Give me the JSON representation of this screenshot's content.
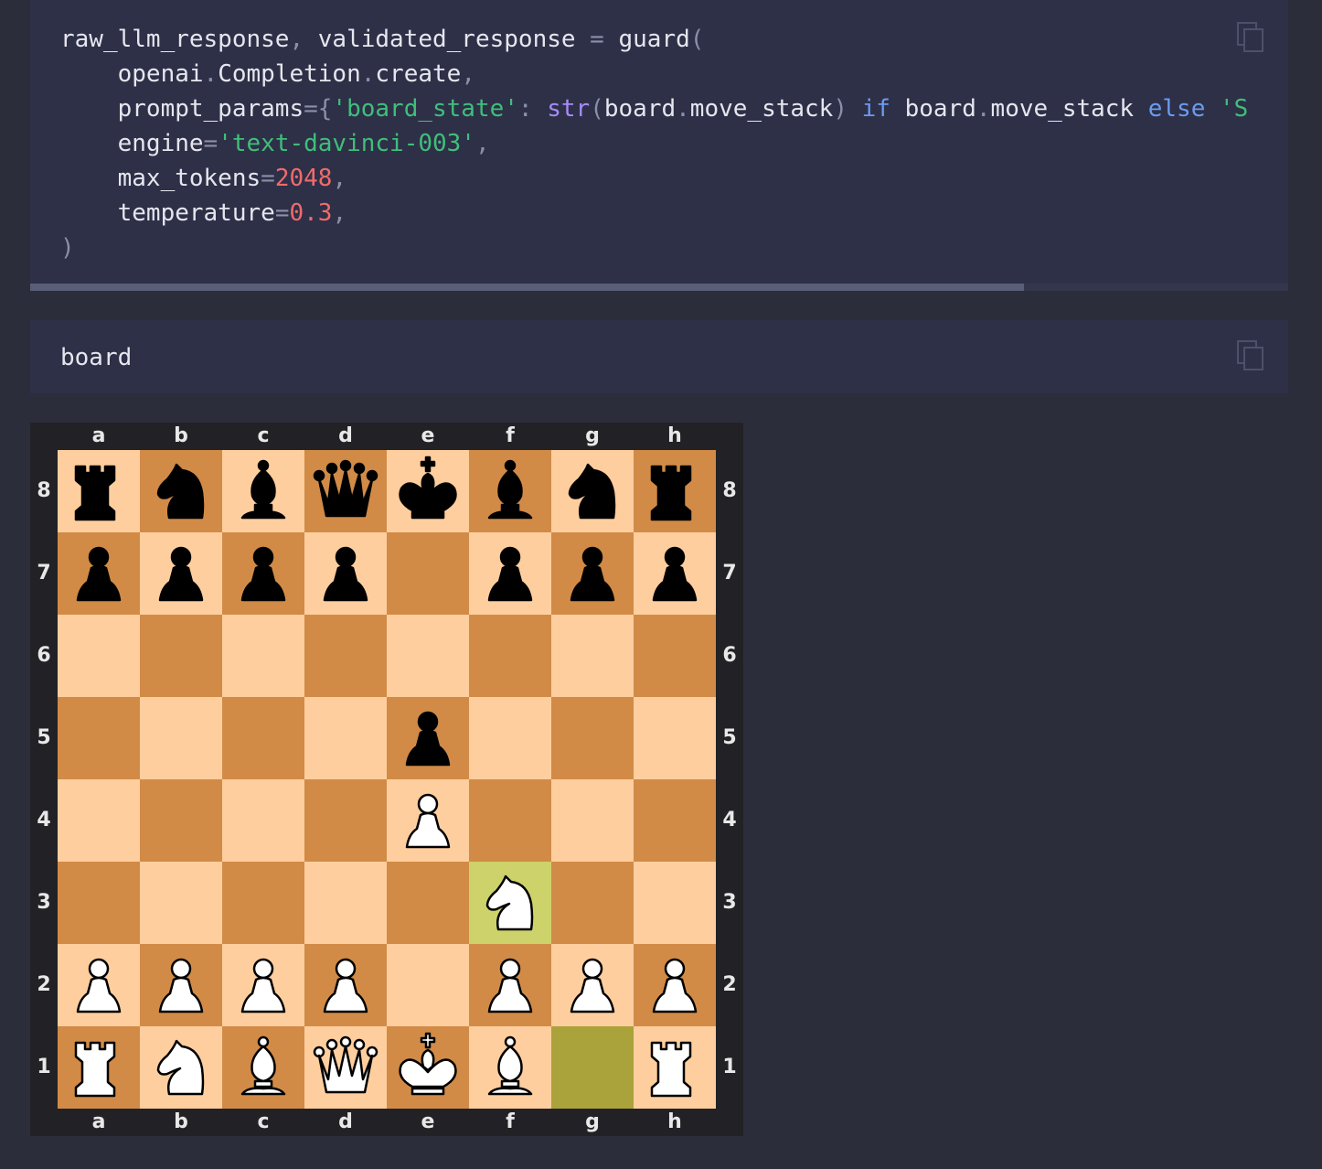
{
  "code_cell_1": {
    "lines": [
      [
        [
          "raw_llm_response",
          "t"
        ],
        [
          ", ",
          "p"
        ],
        [
          "validated_response",
          "t"
        ],
        [
          " = ",
          "p"
        ],
        [
          "guard",
          "t"
        ],
        [
          "(",
          "p"
        ]
      ],
      [
        [
          "    openai",
          "t"
        ],
        [
          ".",
          "p"
        ],
        [
          "Completion",
          "t"
        ],
        [
          ".",
          "p"
        ],
        [
          "create",
          "t"
        ],
        [
          ",",
          "p"
        ]
      ],
      [
        [
          "    prompt_params",
          "t"
        ],
        [
          "={",
          "p"
        ],
        [
          "'board_state'",
          "s"
        ],
        [
          ": ",
          "p"
        ],
        [
          "str",
          "b"
        ],
        [
          "(",
          "p"
        ],
        [
          "board",
          "t"
        ],
        [
          ".",
          "p"
        ],
        [
          "move_stack",
          "t"
        ],
        [
          ") ",
          "p"
        ],
        [
          "if",
          "k"
        ],
        [
          " board",
          "t"
        ],
        [
          ".",
          "p"
        ],
        [
          "move_stack",
          "t"
        ],
        [
          " ",
          "p"
        ],
        [
          "else",
          "k"
        ],
        [
          " 'S",
          "s"
        ]
      ],
      [
        [
          "    engine",
          "t"
        ],
        [
          "=",
          "p"
        ],
        [
          "'text-davinci-003'",
          "s"
        ],
        [
          ",",
          "p"
        ]
      ],
      [
        [
          "    max_tokens",
          "t"
        ],
        [
          "=",
          "p"
        ],
        [
          "2048",
          "n"
        ],
        [
          ",",
          "p"
        ]
      ],
      [
        [
          "    temperature",
          "t"
        ],
        [
          "=",
          "p"
        ],
        [
          "0.3",
          "n"
        ],
        [
          ",",
          "p"
        ]
      ],
      [
        [
          ")",
          "p"
        ]
      ]
    ],
    "copy_icon": "copy-icon",
    "scroll_position": 0.79
  },
  "code_cell_2": {
    "code": "board",
    "copy_icon": "copy-icon"
  },
  "board": {
    "files": [
      "a",
      "b",
      "c",
      "d",
      "e",
      "f",
      "g",
      "h"
    ],
    "ranks": [
      "8",
      "7",
      "6",
      "5",
      "4",
      "3",
      "2",
      "1"
    ],
    "fen_rows": [
      "rnbqkbnr",
      "pppp.ppp",
      "........",
      "....p...",
      "....P...",
      ".....N..",
      "PPPP.PPP",
      "RNBQKB.R"
    ],
    "highlight_from": "g1",
    "highlight_to": "f3",
    "colors": {
      "light": "#ffce9e",
      "dark": "#d18b47",
      "last_move_light": "#cdd26a",
      "last_move_dark": "#aaa23b",
      "frame": "#222226"
    }
  }
}
